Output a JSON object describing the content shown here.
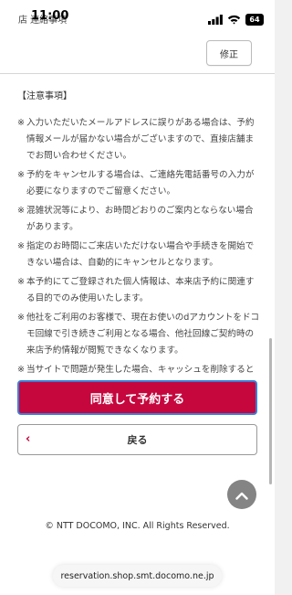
{
  "status_bar": {
    "time": "11:00",
    "underlay_text": "店 連絡事項",
    "battery": "64",
    "signal_icon": "cellular-signal-icon",
    "wifi_icon": "wifi-icon"
  },
  "header": {
    "edit_label": "修正"
  },
  "notice": {
    "title": "【注意事項】",
    "mark": "※",
    "items": [
      "入力いただいたメールアドレスに誤りがある場合は、予約情報メールが届かない場合がございますので、直接店舗までお問い合わせください。",
      "予約をキャンセルする場合は、ご連絡先電話番号の入力が必要になりますのでご留意ください。",
      "混雑状況等により、お時間どおりのご案内とならない場合があります。",
      "指定のお時間にご来店いただけない場合や手続きを開始できない場合は、自動的にキャンセルとなります。",
      "本予約にてご登録された個人情報は、本来店予約に関連する目的でのみ使用いたします。",
      "他社をご利用のお客様で、現在お使いのdアカウントをドコモ回線で引き続きご利用となる場合、他社回線ご契約時の来店予約情報が閲覧できなくなります。",
      "当サイトで問題が発生した場合、キャッシュを削除すると最新の情報が表示され、問題が解決する場合があります。"
    ]
  },
  "actions": {
    "agree_label": "同意して予約する",
    "back_label": "戻る"
  },
  "footer": {
    "copyright": "© NTT DOCOMO, INC. All Rights Reserved."
  },
  "browser": {
    "url": "reservation.shop.smt.docomo.ne.jp"
  },
  "colors": {
    "accent": "#c5073e",
    "focus_ring": "#3b7fd7"
  }
}
